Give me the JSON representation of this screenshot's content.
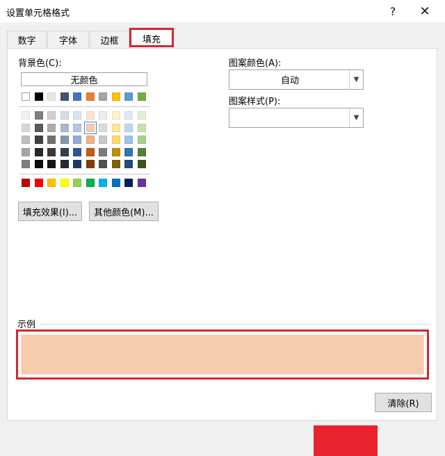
{
  "window": {
    "title": "设置单元格格式",
    "help": "?",
    "close": "✕"
  },
  "tabs": [
    {
      "label": "数字",
      "active": false
    },
    {
      "label": "字体",
      "active": false
    },
    {
      "label": "边框",
      "active": false
    },
    {
      "label": "填充",
      "active": true
    }
  ],
  "background": {
    "label": "背景色(C):",
    "no_color": "无颜色",
    "theme_top": [
      "#ffffff",
      "#000000",
      "#e7e6e6",
      "#44546a",
      "#4472c4",
      "#ed7d31",
      "#a5a5a5",
      "#ffc000",
      "#5b9bd5",
      "#70ad47"
    ],
    "theme_rows": [
      [
        "#f2f2f2",
        "#7f7f7f",
        "#d0cece",
        "#d6dce4",
        "#d9e2f3",
        "#fbe5d5",
        "#ededed",
        "#fff2cc",
        "#deebf6",
        "#e2efd9"
      ],
      [
        "#d8d8d8",
        "#595959",
        "#aeabab",
        "#adb9ca",
        "#b4c6e7",
        "#f7cbac",
        "#dbdbdb",
        "#fee599",
        "#bdd7ee",
        "#c5e0b3"
      ],
      [
        "#bfbfbf",
        "#3f3f3f",
        "#757070",
        "#8496b0",
        "#8eaadb",
        "#f4b183",
        "#c9c9c9",
        "#ffd965",
        "#9dc3e6",
        "#a8d08d"
      ],
      [
        "#a5a5a5",
        "#262626",
        "#3a3838",
        "#323f4f",
        "#2f5496",
        "#c55a11",
        "#7b7b7b",
        "#bf9000",
        "#2e75b5",
        "#538135"
      ],
      [
        "#7f7f7f",
        "#0c0c0c",
        "#161616",
        "#222a35",
        "#1f3864",
        "#843c0b",
        "#525252",
        "#7f6000",
        "#1f4e79",
        "#375623"
      ]
    ],
    "standard": [
      "#c00000",
      "#ff0000",
      "#ffc000",
      "#ffff00",
      "#92d050",
      "#00b050",
      "#00b0f0",
      "#0070c0",
      "#002060",
      "#7030a0"
    ],
    "selected": "#f7cbac",
    "fill_effects_btn": "填充效果(I)...",
    "more_colors_btn": "其他颜色(M)..."
  },
  "pattern": {
    "color_label": "图案颜色(A):",
    "color_value": "自动",
    "style_label": "图案样式(P):",
    "style_value": ""
  },
  "sample": {
    "label": "示例",
    "color": "#f7cbac"
  },
  "clear_btn": "清除(R)",
  "accent": "#d5262f"
}
